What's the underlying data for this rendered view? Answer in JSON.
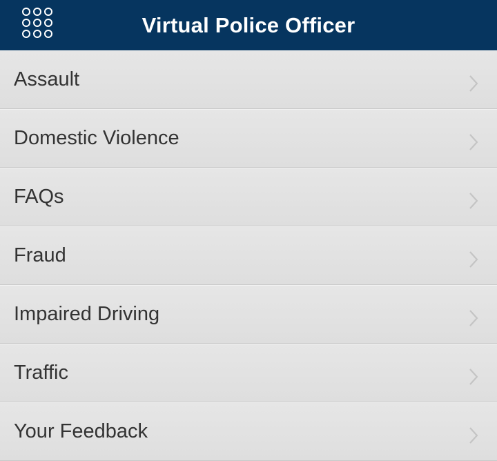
{
  "header": {
    "title": "Virtual Police Officer",
    "menu_icon": "grid-menu-icon",
    "background": "#06355f"
  },
  "list": {
    "chevron_icon": "chevron-right-icon",
    "items": [
      {
        "label": "Assault"
      },
      {
        "label": "Domestic Violence"
      },
      {
        "label": "FAQs"
      },
      {
        "label": "Fraud"
      },
      {
        "label": "Impaired Driving"
      },
      {
        "label": "Traffic"
      },
      {
        "label": "Your Feedback"
      }
    ]
  }
}
